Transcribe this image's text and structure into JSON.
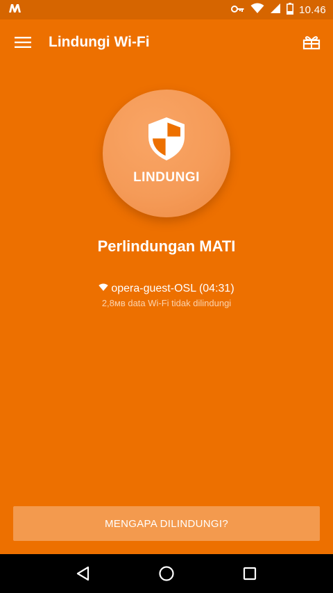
{
  "status_bar": {
    "time": "10.46"
  },
  "app_bar": {
    "title": "Lindungi Wi-Fi"
  },
  "protect": {
    "button_label": "LINDUNGI",
    "status_text": "Perlindungan MATI"
  },
  "network": {
    "name_line": "opera-guest-OSL (04:31)",
    "data_note": "2,8мв data Wi-Fi tidak dilindungi"
  },
  "footer": {
    "why_button_label": "MENGAPA DILINDUNGI?"
  },
  "colors": {
    "background": "#ED7000",
    "status_bar": "#D66500",
    "circle": "#F59B58",
    "why_button": "#F39A4E",
    "nav_bar": "#000000"
  }
}
